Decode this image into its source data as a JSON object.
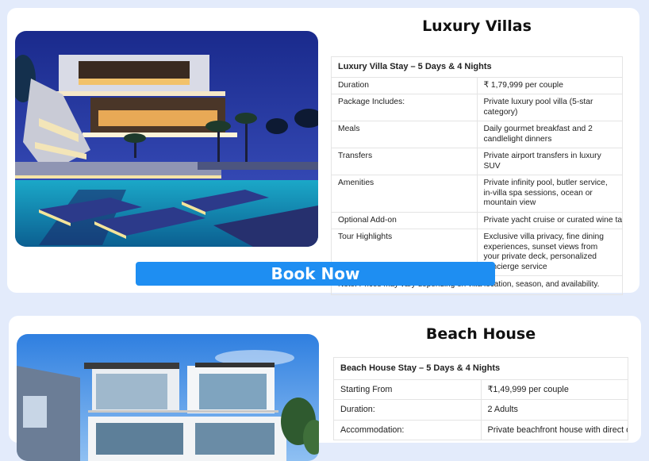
{
  "cards": [
    {
      "title": "Luxury Villas",
      "table_heading": "Luxury Villa Stay – 5 Days & 4 Nights",
      "rows": [
        {
          "label": "Duration",
          "value": "₹ 1,79,999 per couple"
        },
        {
          "label": "Package Includes:",
          "value": "Private luxury pool villa (5-star category)"
        },
        {
          "label": "Meals",
          "value": "Daily gourmet breakfast and 2 candlelight dinners"
        },
        {
          "label": "Transfers",
          "value": "Private airport transfers in luxury SUV"
        },
        {
          "label": "Amenities",
          "value": "Private infinity pool, butler service, in-villa spa sessions, ocean or mountain view"
        },
        {
          "label": "Optional Add-on",
          "value": "Private yacht cruise or curated wine tasting experien-"
        },
        {
          "label": "Tour Highlights",
          "value": "Exclusive villa privacy, fine dining experiences, sunset views from your private deck, personalized concierge service"
        }
      ],
      "note": "Note: Prices may vary depending on villa location, season, and availability.",
      "button_label": "Book Now"
    },
    {
      "title": "Beach House",
      "table_heading": "Beach House Stay – 5 Days & 4 Nights",
      "rows": [
        {
          "label": "Starting From",
          "value": "₹1,49,999 per couple"
        },
        {
          "label": "Duration:",
          "value": "2 Adults"
        },
        {
          "label": "Accommodation:",
          "value": "Private beachfront house with direct ocean access"
        }
      ]
    }
  ],
  "colors": {
    "page_background": "#e3ebfb",
    "card_background": "#ffffff",
    "button": "#1e8ef2"
  }
}
